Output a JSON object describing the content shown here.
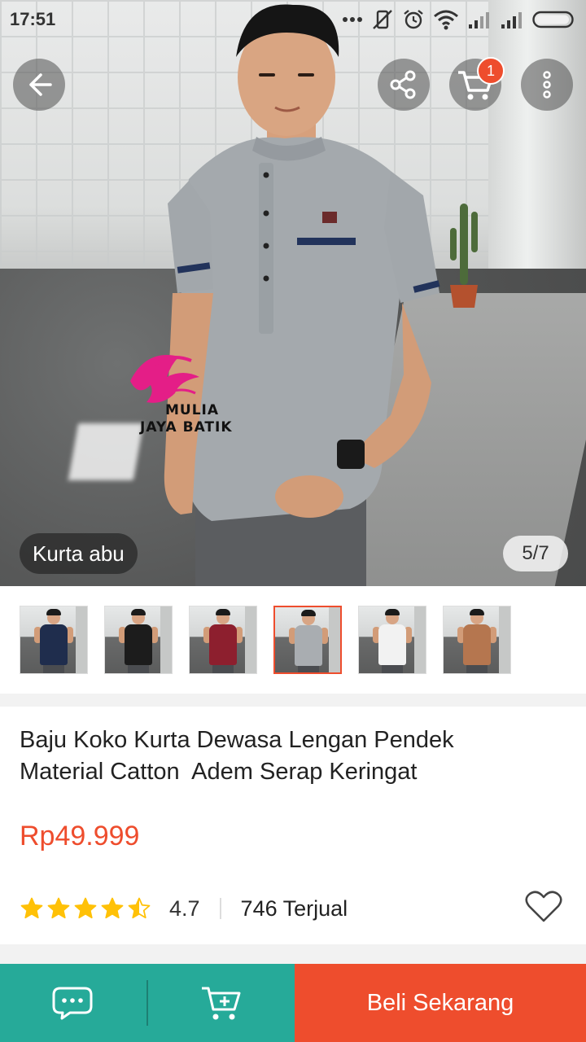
{
  "status_bar": {
    "time": "17:51",
    "icons": [
      "more-dots-icon",
      "vibrate-off-icon",
      "alarm-icon",
      "wifi-icon",
      "signal-icon",
      "signal-icon",
      "battery-icon"
    ]
  },
  "hero": {
    "watermark_line1": "MULIA",
    "watermark_line2": "JAYA BATIK",
    "variant_label": "Kurta abu",
    "page_indicator": "5/7"
  },
  "toolbar": {
    "back_icon": "arrow-left-icon",
    "share_icon": "share-icon",
    "cart_icon": "cart-icon",
    "cart_badge": "1",
    "more_icon": "more-vertical-icon"
  },
  "thumbnails": [
    {
      "color": "#1f2d4d",
      "selected": false
    },
    {
      "color": "#1c1c1c",
      "selected": false
    },
    {
      "color": "#8d1f2e",
      "selected": false
    },
    {
      "color": "#a9adb1",
      "selected": true
    },
    {
      "color": "#f2f2f2",
      "selected": false
    },
    {
      "color": "#b5764f",
      "selected": false
    }
  ],
  "product": {
    "title": "Baju Koko Kurta Dewasa Lengan Pendek Material Catton  Adem Serap Keringat",
    "price": "Rp49.999",
    "rating": "4.7",
    "rating_stars": 4.5,
    "sold": "746 Terjual"
  },
  "bottom_bar": {
    "chat_icon": "chat-icon",
    "add_cart_icon": "cart-plus-icon",
    "buy_label": "Beli Sekarang"
  },
  "colors": {
    "accent": "#ee4d2d",
    "teal": "#26aa99",
    "star": "#ffc107"
  }
}
